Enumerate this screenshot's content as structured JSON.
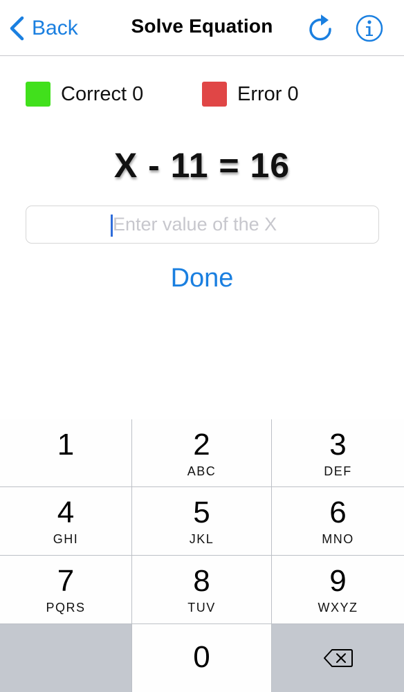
{
  "nav": {
    "back_label": "Back",
    "title": "Solve Equation",
    "refresh_icon": "refresh-icon",
    "info_icon": "info-icon",
    "accent_color": "#1a7fe0"
  },
  "legend": {
    "correct_label": "Correct 0",
    "correct_color": "#41e01c",
    "error_label": "Error 0",
    "error_color": "#e04646"
  },
  "equation": "X - 11 = 16",
  "answer_input": {
    "value": "",
    "placeholder": "Enter value of the X"
  },
  "done_label": "Done",
  "keypad": {
    "keys": [
      {
        "digit": "1",
        "letters": ""
      },
      {
        "digit": "2",
        "letters": "ABC"
      },
      {
        "digit": "3",
        "letters": "DEF"
      },
      {
        "digit": "4",
        "letters": "GHI"
      },
      {
        "digit": "5",
        "letters": "JKL"
      },
      {
        "digit": "6",
        "letters": "MNO"
      },
      {
        "digit": "7",
        "letters": "PQRS"
      },
      {
        "digit": "8",
        "letters": "TUV"
      },
      {
        "digit": "9",
        "letters": "WXYZ"
      },
      {
        "digit": "0",
        "letters": ""
      }
    ],
    "delete_icon": "backspace-icon"
  }
}
